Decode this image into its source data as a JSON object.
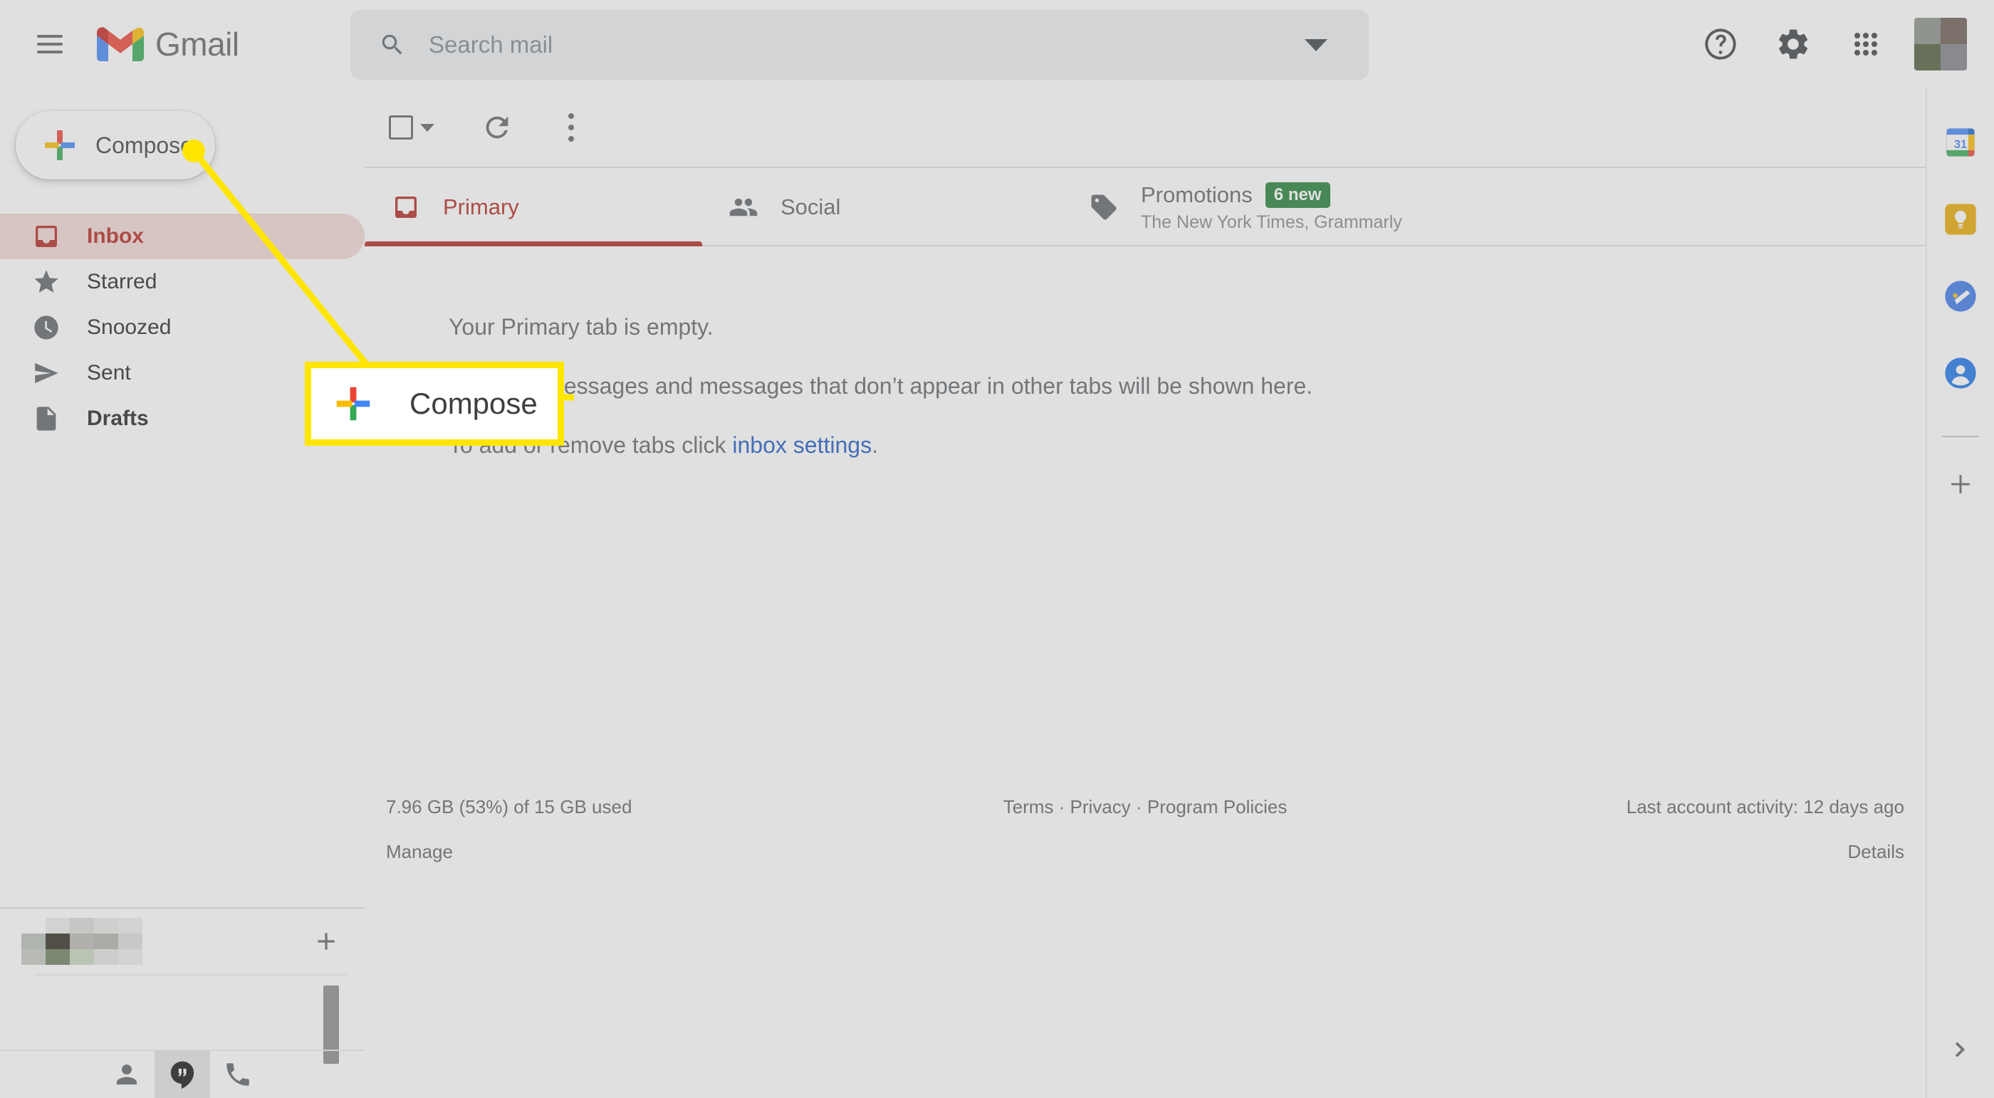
{
  "header": {
    "menu_icon": "hamburger-menu-icon",
    "logo_icon": "gmail-logo-icon",
    "brand": "Gmail",
    "search": {
      "icon": "search-icon",
      "placeholder": "Search mail",
      "value": "",
      "options_icon": "chevron-down-icon"
    },
    "actions": [
      {
        "icon": "help-icon",
        "name": "help-button"
      },
      {
        "icon": "gear-icon",
        "name": "settings-button"
      },
      {
        "icon": "apps-grid-icon",
        "name": "google-apps-button"
      }
    ],
    "avatar": {
      "name": "account-avatar",
      "pixelated": true
    }
  },
  "sidebar": {
    "compose": {
      "label": "Compose",
      "icon": "colored-plus-icon"
    },
    "items": [
      {
        "label": "Inbox",
        "icon": "inbox-icon",
        "active": true,
        "bold": true
      },
      {
        "label": "Starred",
        "icon": "star-icon",
        "active": false,
        "bold": false
      },
      {
        "label": "Snoozed",
        "icon": "clock-icon",
        "active": false,
        "bold": false
      },
      {
        "label": "Sent",
        "icon": "send-icon",
        "active": false,
        "bold": false
      },
      {
        "label": "Drafts",
        "icon": "document-icon",
        "active": false,
        "bold": true
      }
    ]
  },
  "chat_panel": {
    "add_icon": "plus-icon",
    "scrollbar": "chat-scrollbar",
    "tabs": [
      {
        "icon": "person-icon",
        "name": "contacts-tab",
        "active": false
      },
      {
        "icon": "hangouts-icon",
        "name": "chat-tab",
        "active": true
      },
      {
        "icon": "phone-icon",
        "name": "calls-tab",
        "active": false
      }
    ]
  },
  "toolbar": {
    "select_all": {
      "icon": "checkbox-icon",
      "caret": "chevron-down-icon"
    },
    "refresh": {
      "icon": "refresh-icon"
    },
    "more": {
      "icon": "more-vertical-icon"
    }
  },
  "tabs": [
    {
      "label": "Primary",
      "icon": "inbox-icon",
      "sub": "",
      "badge": "",
      "active": true
    },
    {
      "label": "Social",
      "icon": "people-icon",
      "sub": "",
      "badge": "",
      "active": false
    },
    {
      "label": "Promotions",
      "icon": "tag-icon",
      "sub": "The New York Times, Grammarly",
      "badge": "6 new",
      "active": false
    }
  ],
  "empty_state": {
    "line1": "Your Primary tab is empty.",
    "line2": "Personal messages and messages that don’t appear in other tabs will be shown here.",
    "line3_prefix": "To add or remove tabs click ",
    "line3_link": "inbox settings",
    "line3_suffix": "."
  },
  "footer": {
    "storage": "7.96 GB (53%) of 15 GB used",
    "manage": "Manage",
    "links": "Terms · Privacy · Program Policies",
    "activity": "Last account activity: 12 days ago",
    "details": "Details"
  },
  "right_rail": {
    "items": [
      {
        "icon": "google-calendar-icon",
        "name": "calendar-app"
      },
      {
        "icon": "google-keep-icon",
        "name": "keep-app"
      },
      {
        "icon": "google-tasks-icon",
        "name": "tasks-app"
      },
      {
        "icon": "google-contacts-icon",
        "name": "contacts-app"
      }
    ],
    "add_icon": "plus-icon",
    "expand_icon": "chevron-right-icon"
  },
  "callout": {
    "label": "Compose",
    "icon": "colored-plus-icon",
    "accent": "#ffe600"
  },
  "colors": {
    "accent_red": "#b3261e",
    "link_blue": "#1a56c5",
    "badge_green": "#1e7e34",
    "highlight_yellow": "#ffe600"
  }
}
